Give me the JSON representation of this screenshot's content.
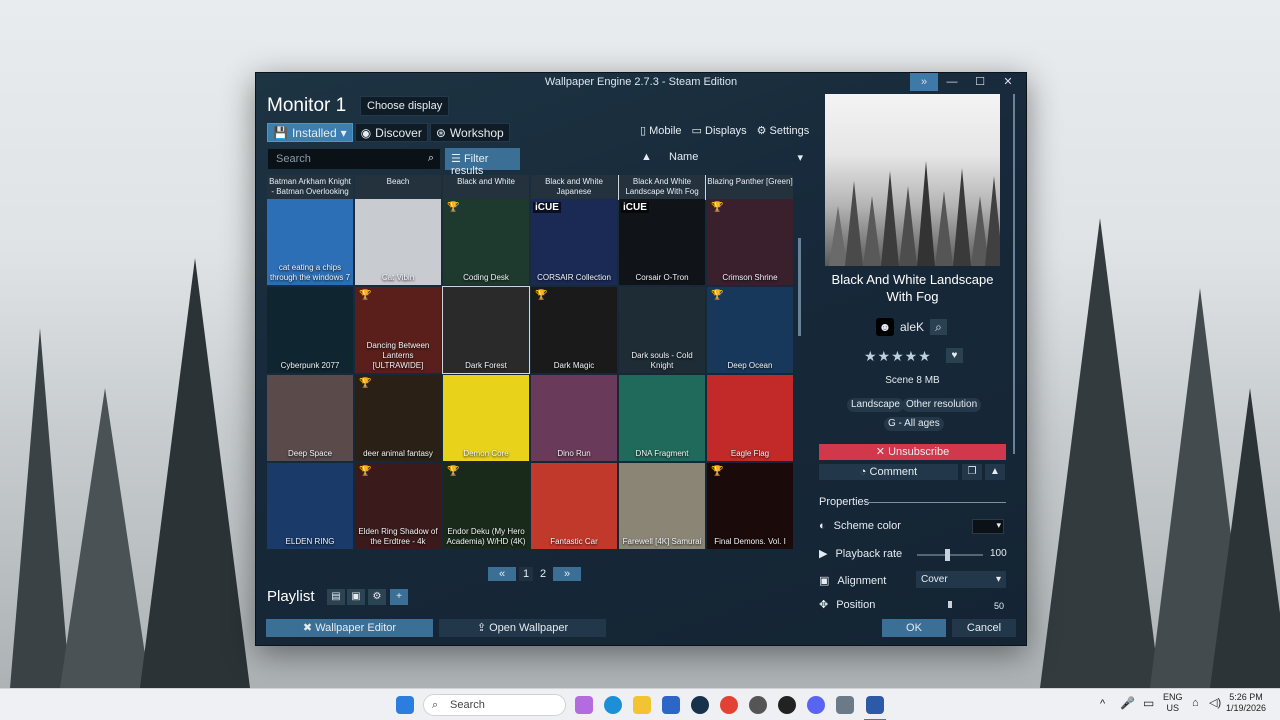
{
  "window": {
    "title": "Wallpaper Engine 2.7.3 - Steam Edition",
    "expand_icon": "»",
    "minimize_icon": "—",
    "maximize_icon": "☐",
    "close_icon": "✕"
  },
  "header": {
    "monitor_title": "Monitor 1",
    "choose_display": "Choose display",
    "tabs": [
      {
        "label": "Installed",
        "icon": "save-icon",
        "active": true
      },
      {
        "label": "Discover",
        "icon": "compass-icon",
        "active": false
      },
      {
        "label": "Workshop",
        "icon": "steam-icon",
        "active": false
      }
    ],
    "links": {
      "mobile": "Mobile",
      "displays": "Displays",
      "settings": "Settings"
    }
  },
  "toolbar": {
    "search_placeholder": "Search",
    "filter_label": "Filter results",
    "sort_label": "Name"
  },
  "grid": {
    "strip": [
      "Batman Arkham Knight - Batman Overlooking",
      "Beach",
      "Black and White",
      "Black and White Japanese",
      "Black And White Landscape With Fog",
      "Blazing Panther [Green]"
    ],
    "items": [
      {
        "label": "cat eating a chips through the windows 7",
        "badge": "",
        "bg": "#2d6fb6"
      },
      {
        "label": "Cat Vibin",
        "badge": "",
        "bg": "#c8ccd0"
      },
      {
        "label": "Coding Desk",
        "badge": "trophy",
        "bg": "#1e3a2e"
      },
      {
        "label": "CORSAIR Collection",
        "badge": "cue",
        "bg": "#1a2a55"
      },
      {
        "label": "Corsair O-Tron",
        "badge": "cue",
        "bg": "#101418"
      },
      {
        "label": "Crimson Shrine",
        "badge": "trophy",
        "bg": "#3a1f2c"
      },
      {
        "label": "Cyberpunk 2077",
        "badge": "",
        "bg": "#0f2530"
      },
      {
        "label": "Dancing Between Lanterns [ULTRAWIDE]",
        "badge": "trophy",
        "bg": "#5a1f1a"
      },
      {
        "label": "Dark Forest",
        "badge": "",
        "bg": "#2a2a2a"
      },
      {
        "label": "Dark Magic",
        "badge": "trophy",
        "bg": "#1a1a1a"
      },
      {
        "label": "Dark souls - Cold Knight",
        "badge": "",
        "bg": "#1e2c36"
      },
      {
        "label": "Deep Ocean",
        "badge": "trophy",
        "bg": "#17385a"
      },
      {
        "label": "Deep Space",
        "badge": "",
        "bg": "#5a4a4a"
      },
      {
        "label": "deer animal fantasy",
        "badge": "trophy",
        "bg": "#2a2015"
      },
      {
        "label": "Demon Core",
        "badge": "",
        "bg": "#e8d21a"
      },
      {
        "label": "Dino Run",
        "badge": "",
        "bg": "#6a3a5a"
      },
      {
        "label": "DNA Fragment",
        "badge": "",
        "bg": "#1f6a5a"
      },
      {
        "label": "Eagle Flag",
        "badge": "",
        "bg": "#c22a2a"
      },
      {
        "label": "ELDEN RING",
        "badge": "",
        "bg": "#1a3a6a"
      },
      {
        "label": "Elden Ring Shadow of the Erdtree - 4k",
        "badge": "trophy",
        "bg": "#3a1a1a"
      },
      {
        "label": "Endor Deku (My Hero Academia) W/HD (4K)",
        "badge": "trophy",
        "bg": "#1a2a1a"
      },
      {
        "label": "Fantastic Car",
        "badge": "",
        "bg": "#c0392b"
      },
      {
        "label": "Farewell [4K] Samurai",
        "badge": "",
        "bg": "#8a8575"
      },
      {
        "label": "Final Demons. Vol. I",
        "badge": "trophy",
        "bg": "#1a0a0a"
      }
    ]
  },
  "pager": {
    "prev": "«",
    "pages": [
      "1",
      "2"
    ],
    "next": "»"
  },
  "playlist": {
    "title": "Playlist"
  },
  "bottom": {
    "wallpaper_editor": "Wallpaper Editor",
    "open_wallpaper": "Open Wallpaper",
    "ok": "OK",
    "cancel": "Cancel"
  },
  "details": {
    "title": "Black And White Landscape With Fog",
    "author": "aleK",
    "stars": "★★★★★",
    "scene": "Scene  8 MB",
    "tags": [
      "Landscape",
      "Other resolution",
      "G - All ages"
    ],
    "unsubscribe": "Unsubscribe",
    "comment": "Comment",
    "properties_title": "Properties",
    "props": [
      {
        "label": "Scheme color",
        "value": ""
      },
      {
        "label": "Playback rate",
        "value": "100"
      },
      {
        "label": "Alignment",
        "value": "Cover"
      },
      {
        "label": "Position",
        "value": "50"
      }
    ]
  },
  "taskbar": {
    "search": "Search",
    "lang": "ENG",
    "region": "US",
    "time": "5:26 PM",
    "date": "1/19/2026"
  },
  "colors": {
    "accent": "#3a7fb0",
    "danger": "#d2384b",
    "window_bg": "#17293a"
  }
}
